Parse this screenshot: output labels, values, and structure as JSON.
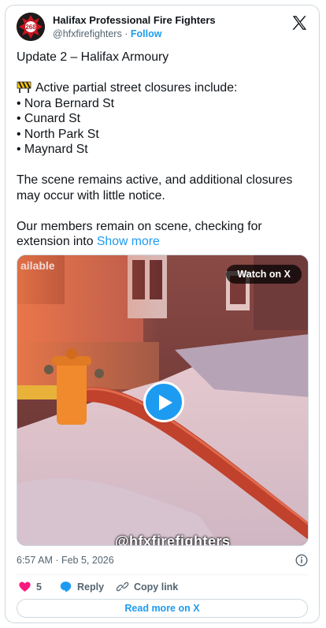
{
  "author": {
    "name": "Halifax Professional Fire Fighters",
    "handle": "@hfxfirefighters",
    "separator": "·",
    "follow_label": "Follow",
    "avatar_badge": "268"
  },
  "tweet": {
    "lines": [
      [
        "Update 2 – Halifax Armoury"
      ],
      [
        "Active partial street closures include:",
        "• Nora Bernard St",
        "• Cunard St",
        "• North Park St",
        "• Maynard St"
      ],
      [
        "The scene remains active, and additional closures",
        "may occur with little notice."
      ],
      [
        "Our members remain on scene, checking for"
      ]
    ],
    "last_line_prefix": "extension into ",
    "show_more_label": "Show more"
  },
  "media": {
    "watch_label": "Watch on X",
    "watermark": "@hfxfirefighters",
    "sign_fragment": "ailable"
  },
  "meta": {
    "timestamp": "6:57 AM · Feb 5, 2026"
  },
  "actions": {
    "likes": "5",
    "reply_label": "Reply",
    "copy_label": "Copy link"
  },
  "footer": {
    "read_more_label": "Read more on X"
  },
  "colors": {
    "accent": "#1d9bf0",
    "like": "#f91880",
    "text": "#0f1419",
    "muted": "#536471",
    "border": "#cfd9de"
  }
}
